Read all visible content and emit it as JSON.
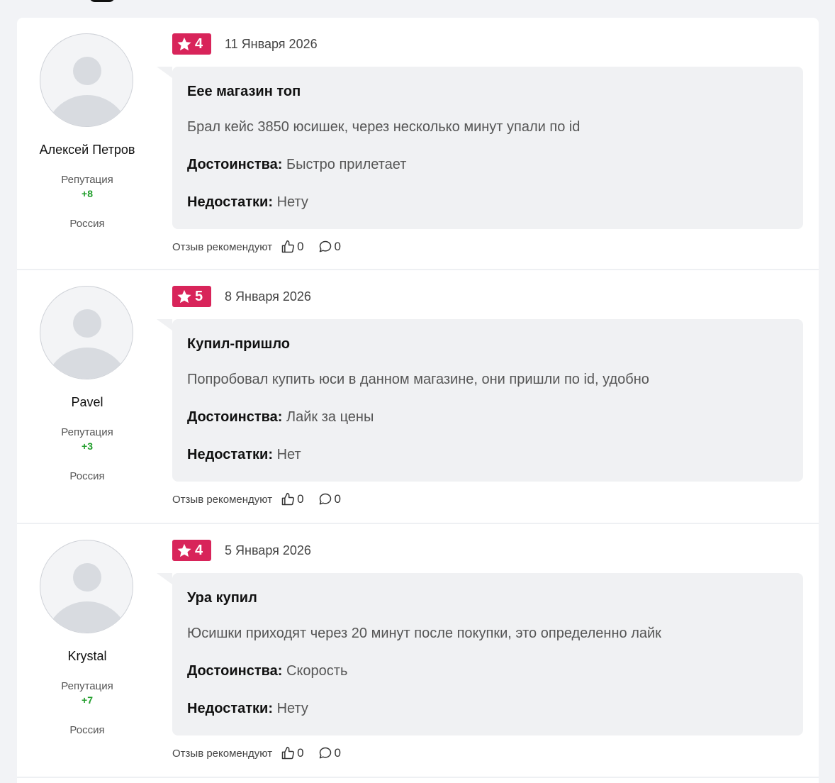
{
  "labels": {
    "reputation": "Репутация",
    "pros": "Достоинства:",
    "cons": "Недостатки:",
    "recommend": "Отзыв рекомендуют"
  },
  "reviews": [
    {
      "author": "Алексей Петров",
      "reputation": "+8",
      "country": "Россия",
      "rating": "4",
      "date": "11 Января 2026",
      "title": "Еее магазин топ",
      "text": "Брал кейс 3850 юсишек, через несколько минут упали по id",
      "pros": "Быстро прилетает",
      "cons": "Нету",
      "likes": "0",
      "comments": "0"
    },
    {
      "author": "Pavel",
      "reputation": "+3",
      "country": "Россия",
      "rating": "5",
      "date": "8 Января 2026",
      "title": "Купил-пришло",
      "text": "Попробовал купить юси в данном магазине, они пришли по id, удобно",
      "pros": "Лайк за цены",
      "cons": "Нет",
      "likes": "0",
      "comments": "0"
    },
    {
      "author": "Krystal",
      "reputation": "+7",
      "country": "Россия",
      "rating": "4",
      "date": "5 Января 2026",
      "title": "Ура купил",
      "text": "Юсишки приходят через 20 минут после покупки, это определенно лайк",
      "pros": "Скорость",
      "cons": "Нету",
      "likes": "0",
      "comments": "0"
    }
  ],
  "colors": {
    "rating_badge": "#d8245a",
    "reputation_positive": "#1f9d2a",
    "bubble_bg": "#f0f1f3",
    "page_bg": "#f2f3f6"
  },
  "icons": {
    "rating": "star-icon",
    "like": "thumbs-up-icon",
    "comment": "comment-bubble-icon",
    "avatar": "user-placeholder-icon"
  }
}
